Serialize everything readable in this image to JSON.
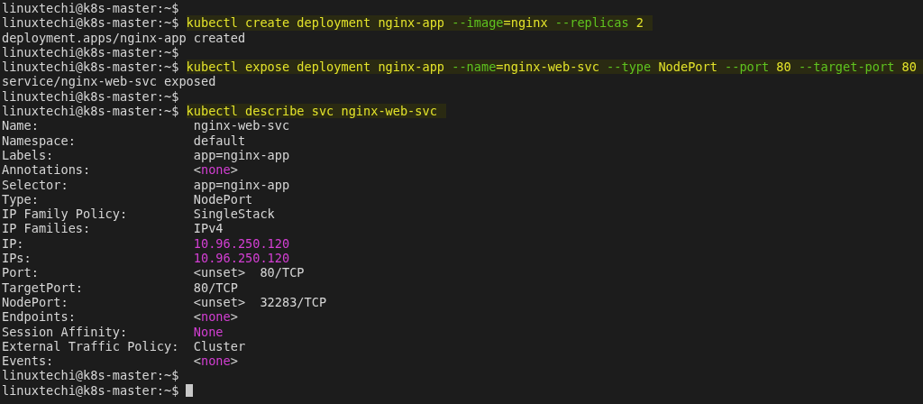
{
  "terminal": {
    "lines": [
      {
        "kind": "prompt",
        "prompt": "linuxtechi@k8s-master:~$",
        "cursor": false
      },
      {
        "kind": "prompt",
        "prompt": "linuxtechi@k8s-master:~$",
        "cursor": false,
        "command": [
          {
            "text": "kubectl create deployment nginx-app ",
            "kind": "cmd"
          },
          {
            "text": "--image",
            "kind": "flag"
          },
          {
            "text": "=nginx ",
            "kind": "cmd"
          },
          {
            "text": "--replicas",
            "kind": "flag"
          },
          {
            "text": " 2",
            "kind": "cmd"
          }
        ]
      },
      {
        "kind": "output",
        "text": "deployment.apps/nginx-app created"
      },
      {
        "kind": "prompt",
        "prompt": "linuxtechi@k8s-master:~$",
        "cursor": false
      },
      {
        "kind": "prompt",
        "prompt": "linuxtechi@k8s-master:~$",
        "cursor": false,
        "command": [
          {
            "text": "kubectl expose deployment nginx-app ",
            "kind": "cmd"
          },
          {
            "text": "--name",
            "kind": "flag"
          },
          {
            "text": "=nginx-web-svc ",
            "kind": "cmd"
          },
          {
            "text": "--type",
            "kind": "flag"
          },
          {
            "text": " NodePort ",
            "kind": "cmd"
          },
          {
            "text": "--port",
            "kind": "flag"
          },
          {
            "text": " 80 ",
            "kind": "cmd"
          },
          {
            "text": "--target-port",
            "kind": "flag"
          },
          {
            "text": " 80",
            "kind": "cmd"
          }
        ]
      },
      {
        "kind": "output",
        "text": "service/nginx-web-svc exposed"
      },
      {
        "kind": "prompt",
        "prompt": "linuxtechi@k8s-master:~$",
        "cursor": false
      },
      {
        "kind": "prompt",
        "prompt": "linuxtechi@k8s-master:~$",
        "cursor": false,
        "command": [
          {
            "text": "kubectl describe svc nginx-web-svc",
            "kind": "cmd"
          }
        ]
      },
      {
        "kind": "field",
        "label": "Name:",
        "value": [
          {
            "text": "nginx-web-svc",
            "kind": "plain"
          }
        ]
      },
      {
        "kind": "field",
        "label": "Namespace:",
        "value": [
          {
            "text": "default",
            "kind": "plain"
          }
        ]
      },
      {
        "kind": "field",
        "label": "Labels:",
        "value": [
          {
            "text": "app=nginx-app",
            "kind": "plain"
          }
        ]
      },
      {
        "kind": "field",
        "label": "Annotations:",
        "value": [
          {
            "text": "<",
            "kind": "plain"
          },
          {
            "text": "none",
            "kind": "magenta"
          },
          {
            "text": ">",
            "kind": "plain"
          }
        ]
      },
      {
        "kind": "field",
        "label": "Selector:",
        "value": [
          {
            "text": "app=nginx-app",
            "kind": "plain"
          }
        ]
      },
      {
        "kind": "field",
        "label": "Type:",
        "value": [
          {
            "text": "NodePort",
            "kind": "plain"
          }
        ]
      },
      {
        "kind": "field",
        "label": "IP Family Policy:",
        "value": [
          {
            "text": "SingleStack",
            "kind": "plain"
          }
        ]
      },
      {
        "kind": "field",
        "label": "IP Families:",
        "value": [
          {
            "text": "IPv4",
            "kind": "plain"
          }
        ]
      },
      {
        "kind": "field",
        "label": "IP:",
        "value": [
          {
            "text": "10.96.250.120",
            "kind": "magenta"
          }
        ]
      },
      {
        "kind": "field",
        "label": "IPs:",
        "value": [
          {
            "text": "10.96.250.120",
            "kind": "magenta"
          }
        ]
      },
      {
        "kind": "field",
        "label": "Port:",
        "value": [
          {
            "text": "<unset>  80/TCP",
            "kind": "plain"
          }
        ]
      },
      {
        "kind": "field",
        "label": "TargetPort:",
        "value": [
          {
            "text": "80/TCP",
            "kind": "plain"
          }
        ]
      },
      {
        "kind": "field",
        "label": "NodePort:",
        "value": [
          {
            "text": "<unset>  32283/TCP",
            "kind": "plain"
          }
        ]
      },
      {
        "kind": "field",
        "label": "Endpoints:",
        "value": [
          {
            "text": "<",
            "kind": "plain"
          },
          {
            "text": "none",
            "kind": "magenta"
          },
          {
            "text": ">",
            "kind": "plain"
          }
        ]
      },
      {
        "kind": "field",
        "label": "Session Affinity:",
        "value": [
          {
            "text": "None",
            "kind": "magenta"
          }
        ]
      },
      {
        "kind": "field",
        "label": "External Traffic Policy:",
        "value": [
          {
            "text": "Cluster",
            "kind": "plain"
          }
        ]
      },
      {
        "kind": "field",
        "label": "Events:",
        "value": [
          {
            "text": "<",
            "kind": "plain"
          },
          {
            "text": "none",
            "kind": "magenta"
          },
          {
            "text": ">",
            "kind": "plain"
          }
        ]
      },
      {
        "kind": "prompt",
        "prompt": "linuxtechi@k8s-master:~$",
        "cursor": false
      },
      {
        "kind": "prompt",
        "prompt": "linuxtechi@k8s-master:~$",
        "cursor": true
      }
    ]
  }
}
